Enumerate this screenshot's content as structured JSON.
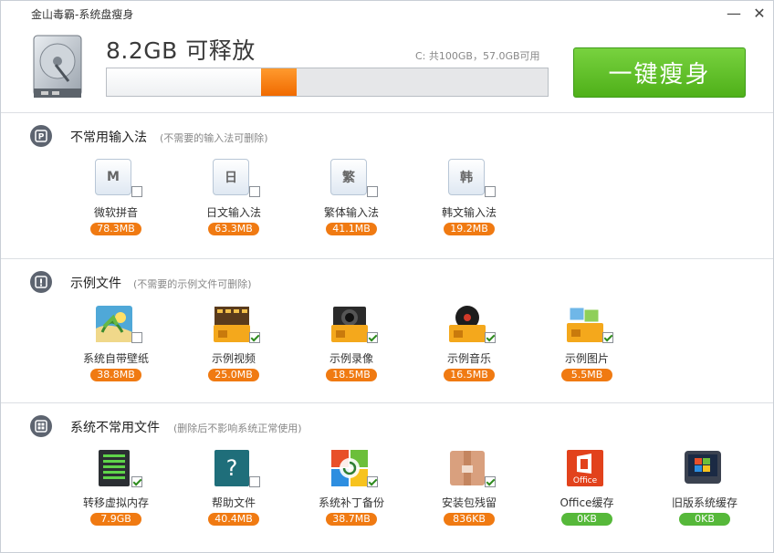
{
  "window": {
    "title": "金山毒霸-系统盘瘦身",
    "minimize": "—",
    "close": "✕"
  },
  "header": {
    "headline": "8.2GB 可释放",
    "disk_usage": "C: 共100GB，57.0GB可用",
    "used_fraction": 0.35,
    "free_fraction": 0.08,
    "button_label": "一键瘦身"
  },
  "sections": {
    "ime": {
      "title": "不常用输入法",
      "subtitle": "(不需要的输入法可删除)",
      "items": [
        {
          "glyph": "M",
          "label": "微软拼音",
          "size": "78.3MB",
          "checked": false
        },
        {
          "glyph": "日",
          "label": "日文输入法",
          "size": "63.3MB",
          "checked": false
        },
        {
          "glyph": "繁",
          "label": "繁体输入法",
          "size": "41.1MB",
          "checked": false
        },
        {
          "glyph": "韩",
          "label": "韩文输入法",
          "size": "19.2MB",
          "checked": false
        }
      ]
    },
    "samples": {
      "title": "示例文件",
      "subtitle": "(不需要的示例文件可删除)",
      "items": [
        {
          "label": "系统自带壁纸",
          "size": "38.8MB",
          "checked": false
        },
        {
          "label": "示例视频",
          "size": "25.0MB",
          "checked": true
        },
        {
          "label": "示例录像",
          "size": "18.5MB",
          "checked": true
        },
        {
          "label": "示例音乐",
          "size": "16.5MB",
          "checked": true
        },
        {
          "label": "示例图片",
          "size": "5.5MB",
          "checked": true
        }
      ]
    },
    "system": {
      "title": "系统不常用文件",
      "subtitle": "(删除后不影响系统正常使用)",
      "items": [
        {
          "label": "转移虚拟内存",
          "size": "7.9GB",
          "checked": true,
          "color": "orange"
        },
        {
          "label": "帮助文件",
          "size": "40.4MB",
          "checked": false,
          "color": "orange"
        },
        {
          "label": "系统补丁备份",
          "size": "38.7MB",
          "checked": true,
          "color": "orange"
        },
        {
          "label": "安装包残留",
          "size": "836KB",
          "checked": true,
          "color": "orange"
        },
        {
          "label": "Office缓存",
          "size": "0KB",
          "checked": false,
          "color": "green",
          "badge": "Office"
        },
        {
          "label": "旧版系统缓存",
          "size": "0KB",
          "checked": false,
          "color": "green"
        }
      ]
    }
  },
  "colors": {
    "accent_orange": "#f07a12",
    "accent_green": "#56b83a",
    "button_green": "#4fb019"
  }
}
